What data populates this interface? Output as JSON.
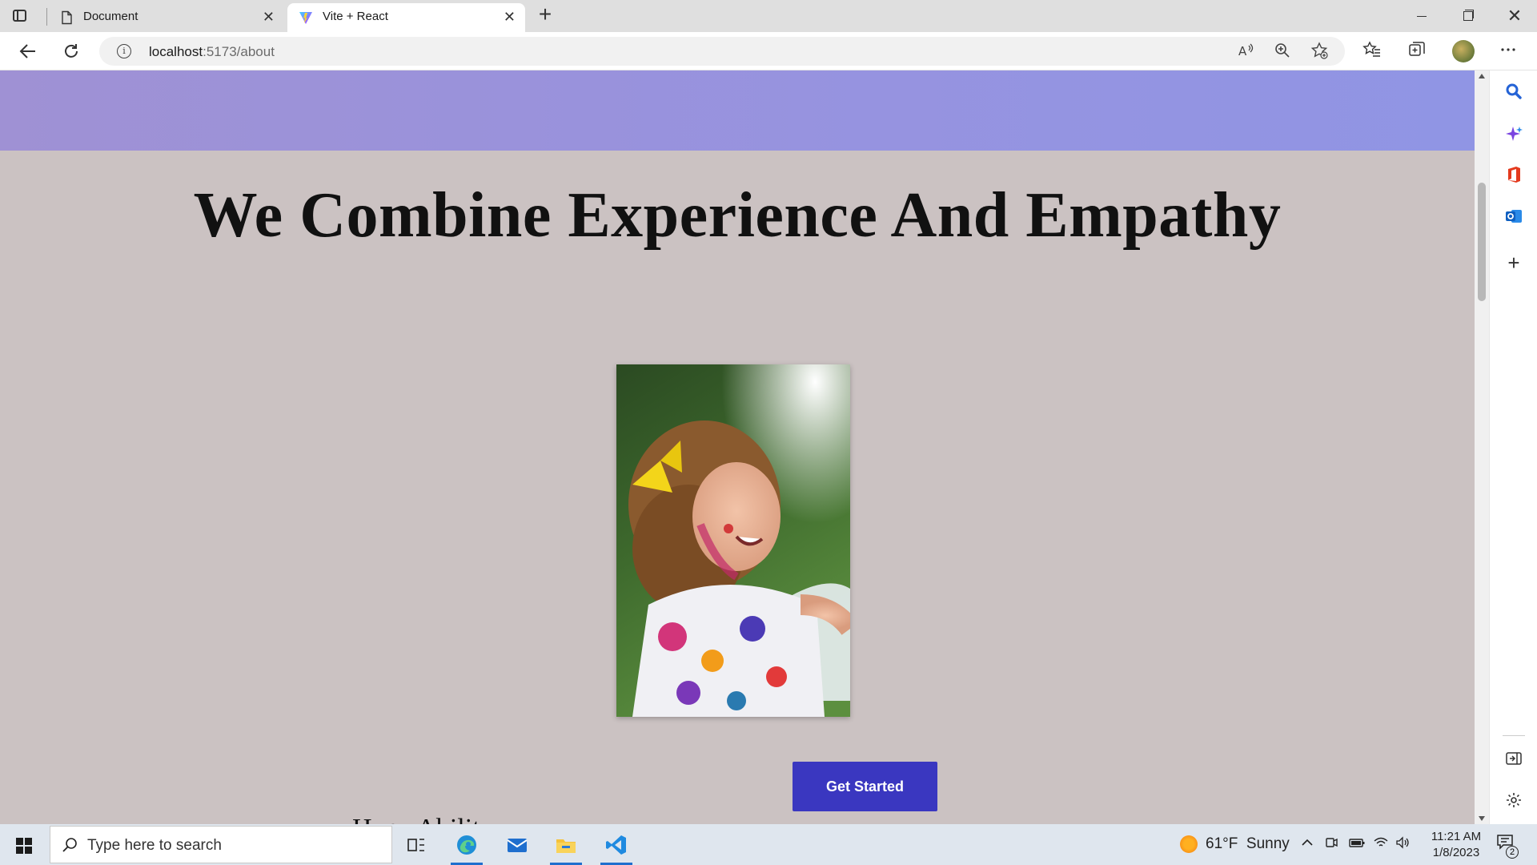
{
  "browser": {
    "tabs": [
      {
        "title": "Document",
        "icon": "document-icon",
        "active": false
      },
      {
        "title": "Vite + React",
        "icon": "vite-logo-icon",
        "active": true
      }
    ],
    "new_tab": "+",
    "address": {
      "host": "localhost",
      "path": ":5173/about"
    },
    "close_glyph": "✕"
  },
  "page": {
    "title": "We Combine Experience And Empathy",
    "photo_alt": "Smiling child with paint on face and dress",
    "cta_label": "Get Started",
    "body_text_partial": "Hope Ability ..."
  },
  "taskbar": {
    "search_placeholder": "Type here to search",
    "weather_temp": "61°F",
    "weather_condition": "Sunny",
    "time": "11:21 AM",
    "date": "1/8/2023",
    "notification_count": "2"
  },
  "colors": {
    "hero_band": "#9a94da",
    "page_bg": "#cbc2c2",
    "cta_bg": "#3a37c0",
    "taskbar_bg": "#dfe6ee"
  }
}
